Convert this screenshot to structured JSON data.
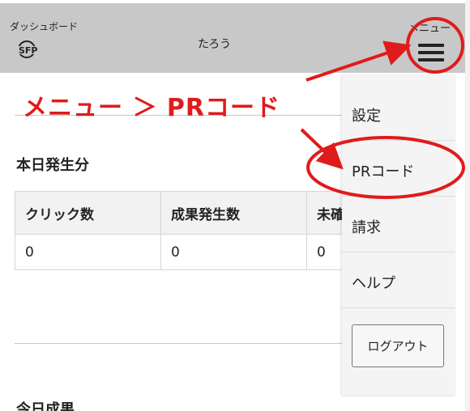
{
  "header": {
    "dashboard_label": "ダッシュボード",
    "logo_text": "SFP",
    "username": "たろう",
    "menu_label": "メニュー",
    "menu_icon": "hamburger-icon"
  },
  "annotation": {
    "text": "メニュー ＞ PRコード",
    "color": "#e01b1b"
  },
  "today": {
    "title": "本日発生分",
    "columns": [
      "クリック数",
      "成果発生数",
      "未確"
    ],
    "values": [
      "0",
      "0",
      "0"
    ]
  },
  "next_section": {
    "title": "今日成果"
  },
  "dropdown_menu": {
    "items": [
      "設定",
      "PRコード",
      "請求",
      "ヘルプ"
    ],
    "logout_label": "ログアウト"
  }
}
